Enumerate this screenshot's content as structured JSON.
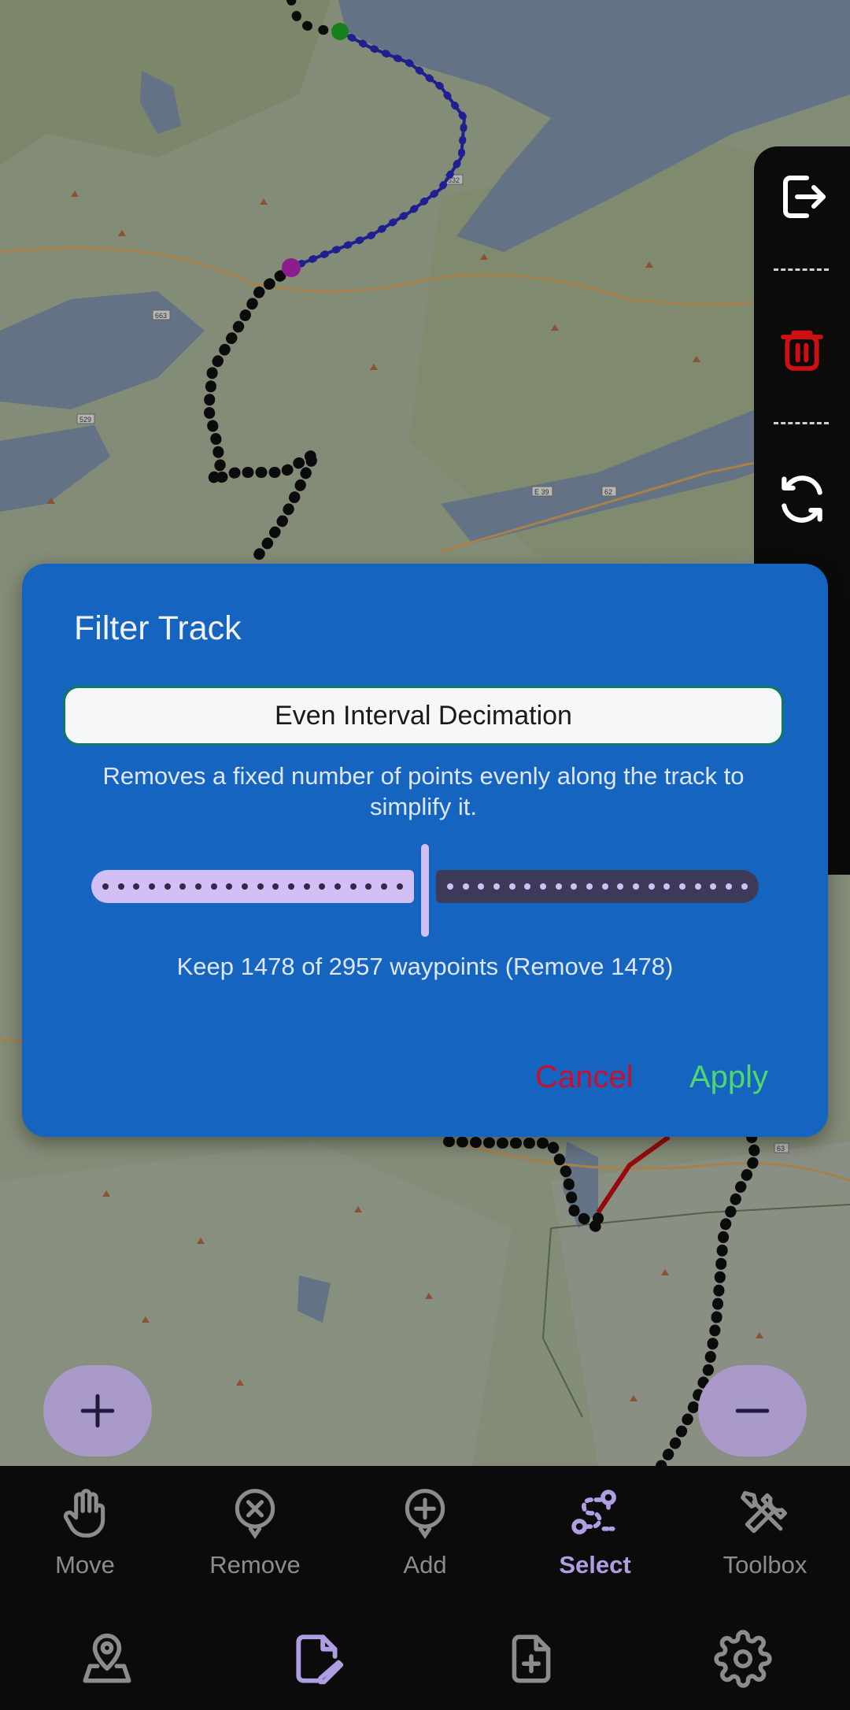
{
  "dialog": {
    "title": "Filter Track",
    "filter_method": "Even Interval Decimation",
    "description": "Removes a fixed number of points evenly along the track to simplify it.",
    "slider_fraction": 0.5,
    "keep_text": "Keep 1478 of 2957 waypoints (Remove 1478)",
    "cancel_label": "Cancel",
    "apply_label": "Apply"
  },
  "map": {
    "road_labels": [
      "532",
      "663",
      "529",
      "E 39",
      "62",
      "63"
    ]
  },
  "side_panel": {
    "items": [
      "exit-icon",
      "trash-icon",
      "sync-icon"
    ]
  },
  "mode_bar": {
    "items": [
      {
        "label": "Move",
        "icon": "hand-icon"
      },
      {
        "label": "Remove",
        "icon": "remove-circle-icon"
      },
      {
        "label": "Add",
        "icon": "add-circle-icon"
      },
      {
        "label": "Select",
        "icon": "select-route-icon"
      },
      {
        "label": "Toolbox",
        "icon": "tools-icon"
      }
    ],
    "active": "Select"
  },
  "action_bar": {
    "items": [
      "map-pin-icon",
      "edit-file-icon",
      "new-file-icon",
      "settings-gear-icon"
    ]
  },
  "colors": {
    "dialog_bg": "#1565c0",
    "cancel": "#c8102e",
    "apply": "#4fd66e",
    "accent": "#b09ee3",
    "track_selected": "#1d1db8",
    "track_default": "#000000"
  }
}
